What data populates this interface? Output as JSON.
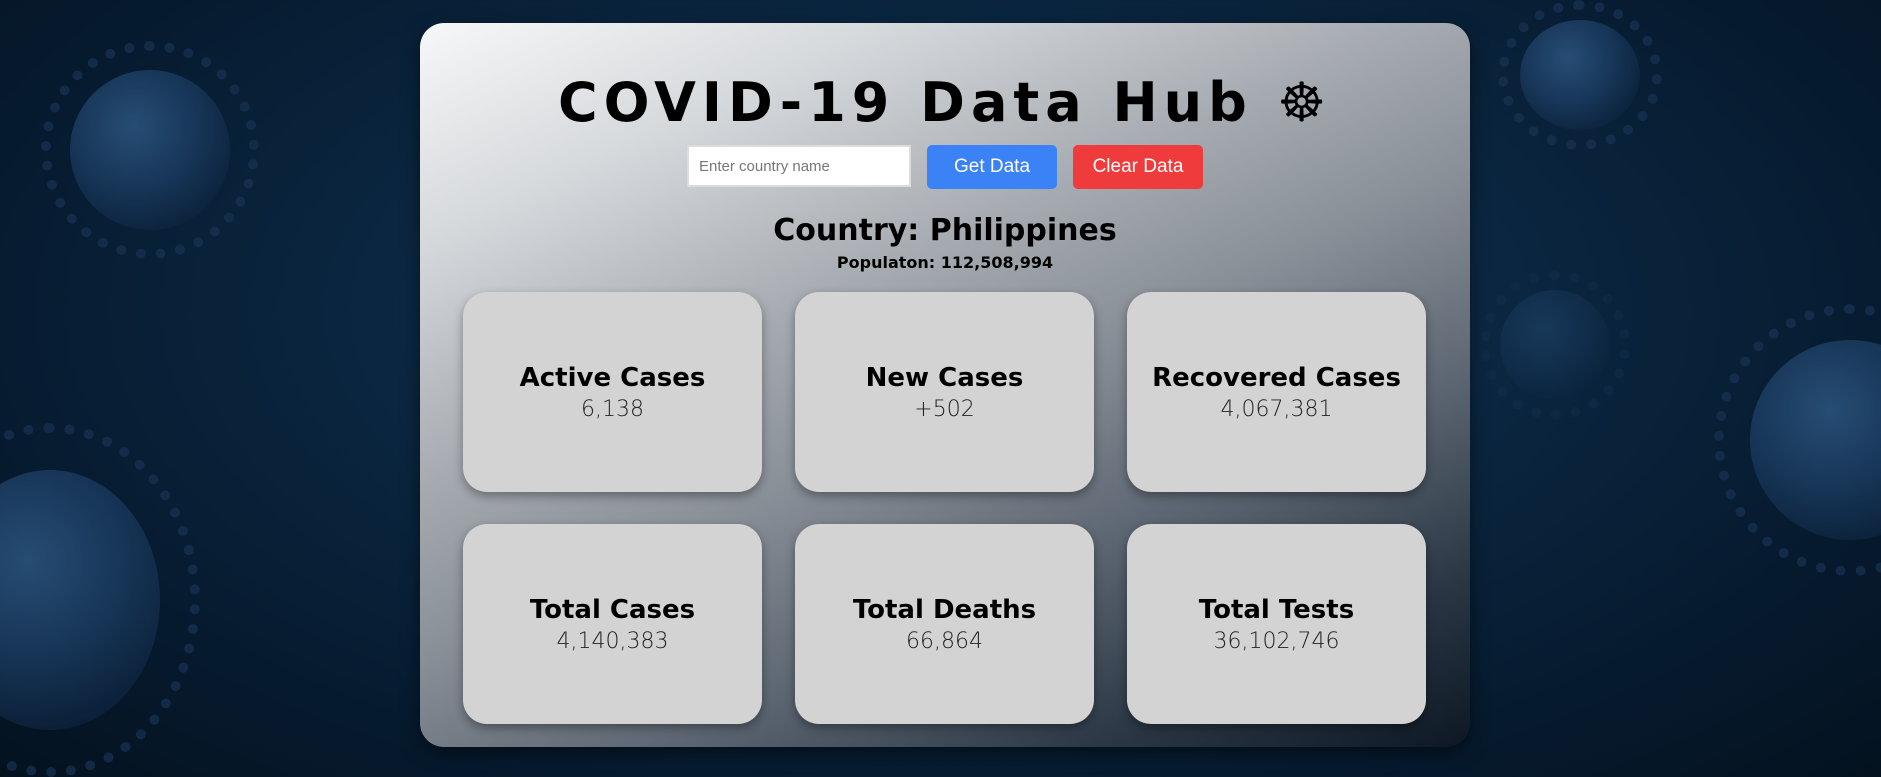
{
  "header": {
    "title": "COVID-19 Data Hub ☸"
  },
  "search": {
    "placeholder": "Enter country name",
    "value": "",
    "get_label": "Get Data",
    "clear_label": "Clear Data"
  },
  "info": {
    "country": "Country: Philippines",
    "population": "Populaton: 112,508,994"
  },
  "stats": [
    {
      "label": "Active Cases",
      "value": "6,138"
    },
    {
      "label": "New Cases",
      "value": "+502"
    },
    {
      "label": "Recovered Cases",
      "value": "4,067,381"
    },
    {
      "label": "Total Cases",
      "value": "4,140,383"
    },
    {
      "label": "Total Deaths",
      "value": "66,864"
    },
    {
      "label": "Total Tests",
      "value": "36,102,746"
    }
  ],
  "colors": {
    "get_button": "#3b82f6",
    "clear_button": "#ef3b3b",
    "card_background": "#d3d3d3"
  }
}
